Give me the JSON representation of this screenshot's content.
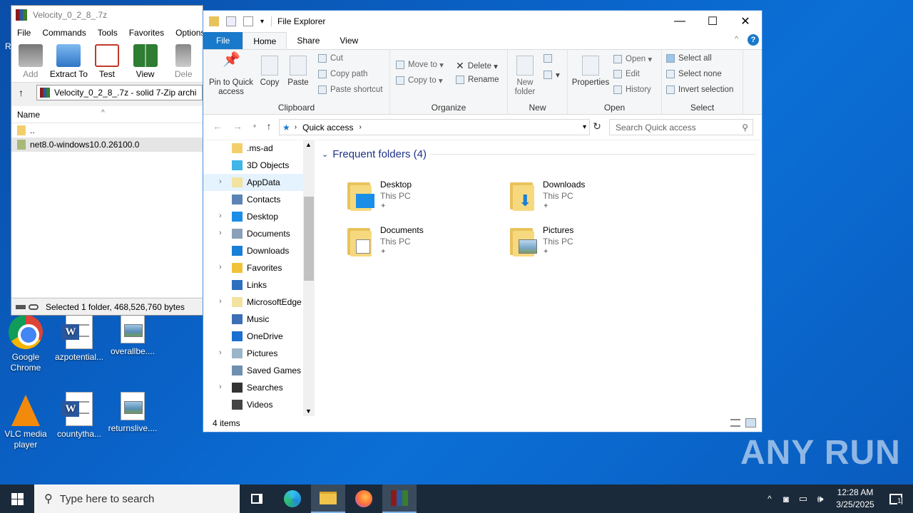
{
  "desktop": {
    "icons": [
      {
        "label": "Google Chrome",
        "label2": ""
      },
      {
        "label": "azpotential...",
        "label2": ""
      },
      {
        "label": "overallbe....",
        "label2": ""
      },
      {
        "label": "VLC media",
        "label2": "player"
      },
      {
        "label": "countytha...",
        "label2": ""
      },
      {
        "label": "returnslive....",
        "label2": ""
      }
    ],
    "chrome_line1": "Google",
    "chrome_line2": "Chrome",
    "edge_stub": "R"
  },
  "winrar": {
    "title": "Velocity_0_2_8_.7z",
    "menu": [
      "File",
      "Commands",
      "Tools",
      "Favorites",
      "Options"
    ],
    "tools": [
      "Add",
      "Extract To",
      "Test",
      "View",
      "Dele"
    ],
    "address": "Velocity_0_2_8_.7z - solid 7-Zip archi",
    "column_name": "Name",
    "rows": [
      "..",
      "net8.0-windows10.0.26100.0"
    ],
    "status": "Selected 1 folder, 468,526,760 bytes"
  },
  "explorer": {
    "title": "File Explorer",
    "tabs": [
      "File",
      "Home",
      "Share",
      "View"
    ],
    "clipboard": {
      "pin": "Pin to Quick access",
      "copy": "Copy",
      "paste": "Paste",
      "cut": "Cut",
      "copy_path": "Copy path",
      "paste_shortcut": "Paste shortcut",
      "label": "Clipboard"
    },
    "organize": {
      "move_to": "Move to",
      "copy_to": "Copy to",
      "delete": "Delete",
      "rename": "Rename",
      "label": "Organize"
    },
    "new": {
      "new_folder": "New folder",
      "label": "New"
    },
    "open": {
      "properties": "Properties",
      "open": "Open",
      "edit": "Edit",
      "history": "History",
      "label": "Open"
    },
    "select": {
      "select_all": "Select all",
      "select_none": "Select none",
      "invert": "Invert selection",
      "label": "Select"
    },
    "address": "Quick access",
    "search_placeholder": "Search Quick access",
    "tree": [
      {
        "label": ".ms-ad",
        "exp": false
      },
      {
        "label": "3D Objects",
        "exp": false
      },
      {
        "label": "AppData",
        "exp": true
      },
      {
        "label": "Contacts",
        "exp": false
      },
      {
        "label": "Desktop",
        "exp": true
      },
      {
        "label": "Documents",
        "exp": true
      },
      {
        "label": "Downloads",
        "exp": false
      },
      {
        "label": "Favorites",
        "exp": true
      },
      {
        "label": "Links",
        "exp": false
      },
      {
        "label": "MicrosoftEdge",
        "exp": true
      },
      {
        "label": "Music",
        "exp": false
      },
      {
        "label": "OneDrive",
        "exp": false
      },
      {
        "label": "Pictures",
        "exp": true
      },
      {
        "label": "Saved Games",
        "exp": false
      },
      {
        "label": "Searches",
        "exp": true
      },
      {
        "label": "Videos",
        "exp": false
      }
    ],
    "section_title": "Frequent folders (4)",
    "folders": [
      {
        "name": "Desktop",
        "sub": "This PC"
      },
      {
        "name": "Downloads",
        "sub": "This PC"
      },
      {
        "name": "Documents",
        "sub": "This PC"
      },
      {
        "name": "Pictures",
        "sub": "This PC"
      }
    ],
    "status": "4 items"
  },
  "taskbar": {
    "search_placeholder": "Type here to search",
    "time": "12:28 AM",
    "date": "3/25/2025",
    "notif_count": "1"
  },
  "watermark": "ANY RUN"
}
